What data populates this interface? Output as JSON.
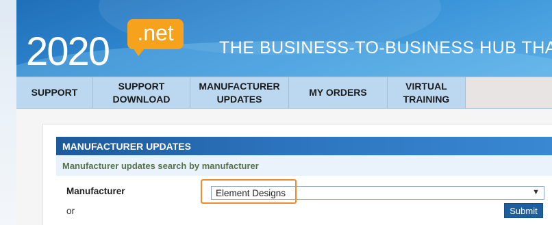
{
  "header": {
    "logo_number": "2020",
    "logo_suffix": ".net",
    "tagline": "THE BUSINESS-TO-BUSINESS HUB THAT KEEPS YO"
  },
  "nav": {
    "items": [
      {
        "label": "SUPPORT"
      },
      {
        "label": "SUPPORT\nDOWNLOAD"
      },
      {
        "label": "MANUFACTURER\nUPDATES"
      },
      {
        "label": "MY ORDERS"
      },
      {
        "label": "VIRTUAL\nTRAINING"
      }
    ]
  },
  "section": {
    "title": "MANUFACTURER UPDATES",
    "subtitle": "Manufacturer updates search by manufacturer"
  },
  "form": {
    "manufacturer_label": "Manufacturer",
    "manufacturer_selected": "Element Designs",
    "or_label": "or",
    "submit_label": "Submit"
  },
  "colors": {
    "header_blue": "#2f86cf",
    "nav_blue": "#bcd8f1",
    "section_bar": "#2c73bd",
    "logo_orange": "#f6a21d",
    "highlight_orange": "#f08a2c",
    "submit_blue": "#1d5e9e"
  }
}
